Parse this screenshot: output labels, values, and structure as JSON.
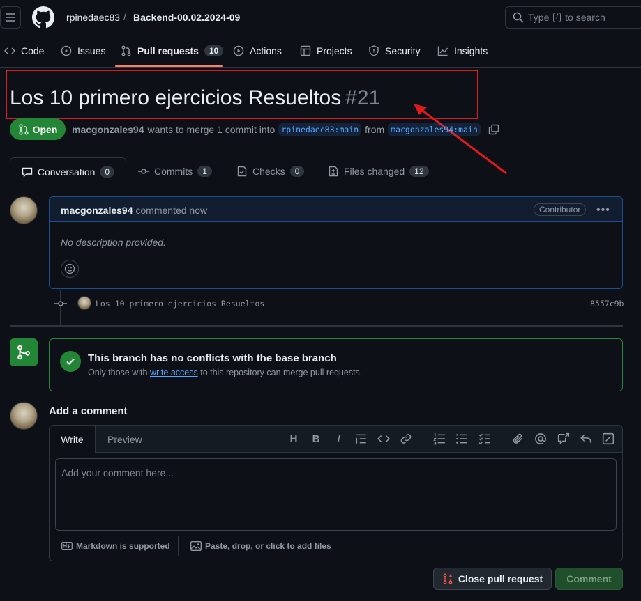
{
  "header": {
    "owner": "rpinedaec83",
    "separator": "/",
    "repo": "Backend-00.02.2024-09",
    "search_prefix": "Type",
    "search_key": "/",
    "search_suffix": "to search"
  },
  "repo_nav": [
    {
      "label": "Code",
      "icon": "code-icon"
    },
    {
      "label": "Issues",
      "icon": "issue-icon"
    },
    {
      "label": "Pull requests",
      "icon": "pull-request-icon",
      "count": "10",
      "active": true
    },
    {
      "label": "Actions",
      "icon": "play-icon"
    },
    {
      "label": "Projects",
      "icon": "table-icon"
    },
    {
      "label": "Security",
      "icon": "shield-icon"
    },
    {
      "label": "Insights",
      "icon": "graph-icon"
    }
  ],
  "pr": {
    "title": "Los 10 primero ejercicios Resueltos",
    "number": "#21",
    "state": "Open",
    "author": "macgonzales94",
    "meta_text": "wants to merge 1 commit into",
    "base_branch": "rpinedaec83:main",
    "from_text": "from",
    "head_branch": "macgonzales94:main"
  },
  "tabs": [
    {
      "label": "Conversation",
      "count": "0"
    },
    {
      "label": "Commits",
      "count": "1"
    },
    {
      "label": "Checks",
      "count": "0"
    },
    {
      "label": "Files changed",
      "count": "12"
    }
  ],
  "comment": {
    "author": "macgonzales94",
    "time": "commented now",
    "role": "Contributor",
    "body": "No description provided."
  },
  "commit": {
    "message": "Los 10 primero ejercicios Resueltos",
    "sha": "8557c9b"
  },
  "merge": {
    "title": "This branch has no conflicts with the base branch",
    "sub_prefix": "Only those with",
    "sub_link": "write access",
    "sub_suffix": "to this repository can merge pull requests."
  },
  "add_comment": {
    "heading": "Add a comment",
    "tab_write": "Write",
    "tab_preview": "Preview",
    "placeholder": "Add your comment here...",
    "markdown_note": "Markdown is supported",
    "files_note": "Paste, drop, or click to add files",
    "close_button": "Close pull request",
    "comment_button": "Comment"
  },
  "colors": {
    "background": "#0d1117",
    "accent_green": "#238636",
    "link_blue": "#58a6ff",
    "annotation_red": "#e01a1a",
    "tab_underline": "#f78166"
  }
}
